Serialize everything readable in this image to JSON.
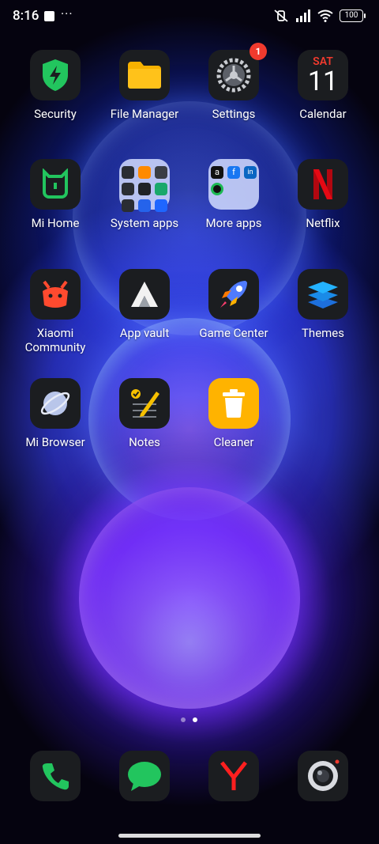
{
  "status": {
    "time": "8:16",
    "battery": "100"
  },
  "apps": {
    "security": "Security",
    "file_manager": "File Manager",
    "settings": "Settings",
    "settings_badge": "1",
    "calendar": "Calendar",
    "calendar_day": "SAT",
    "calendar_date": "11",
    "mi_home": "Mi Home",
    "system_apps": "System apps",
    "more_apps": "More apps",
    "netflix": "Netflix",
    "xiaomi_community": "Xiaomi\nCommunity",
    "app_vault": "App vault",
    "game_center": "Game Center",
    "themes": "Themes",
    "mi_browser": "Mi Browser",
    "notes": "Notes",
    "cleaner": "Cleaner"
  },
  "icons": {
    "security": "shield-bolt-icon",
    "settings": "gear-icon",
    "phone": "phone-icon",
    "messages": "chat-bubble-icon",
    "browser": "yandex-y-icon",
    "camera": "camera-icon"
  },
  "colors": {
    "accent_green": "#22c55e",
    "netflix_red": "#e50914",
    "badge_red": "#f03a2e",
    "folder_bg": "#d2dcff"
  }
}
